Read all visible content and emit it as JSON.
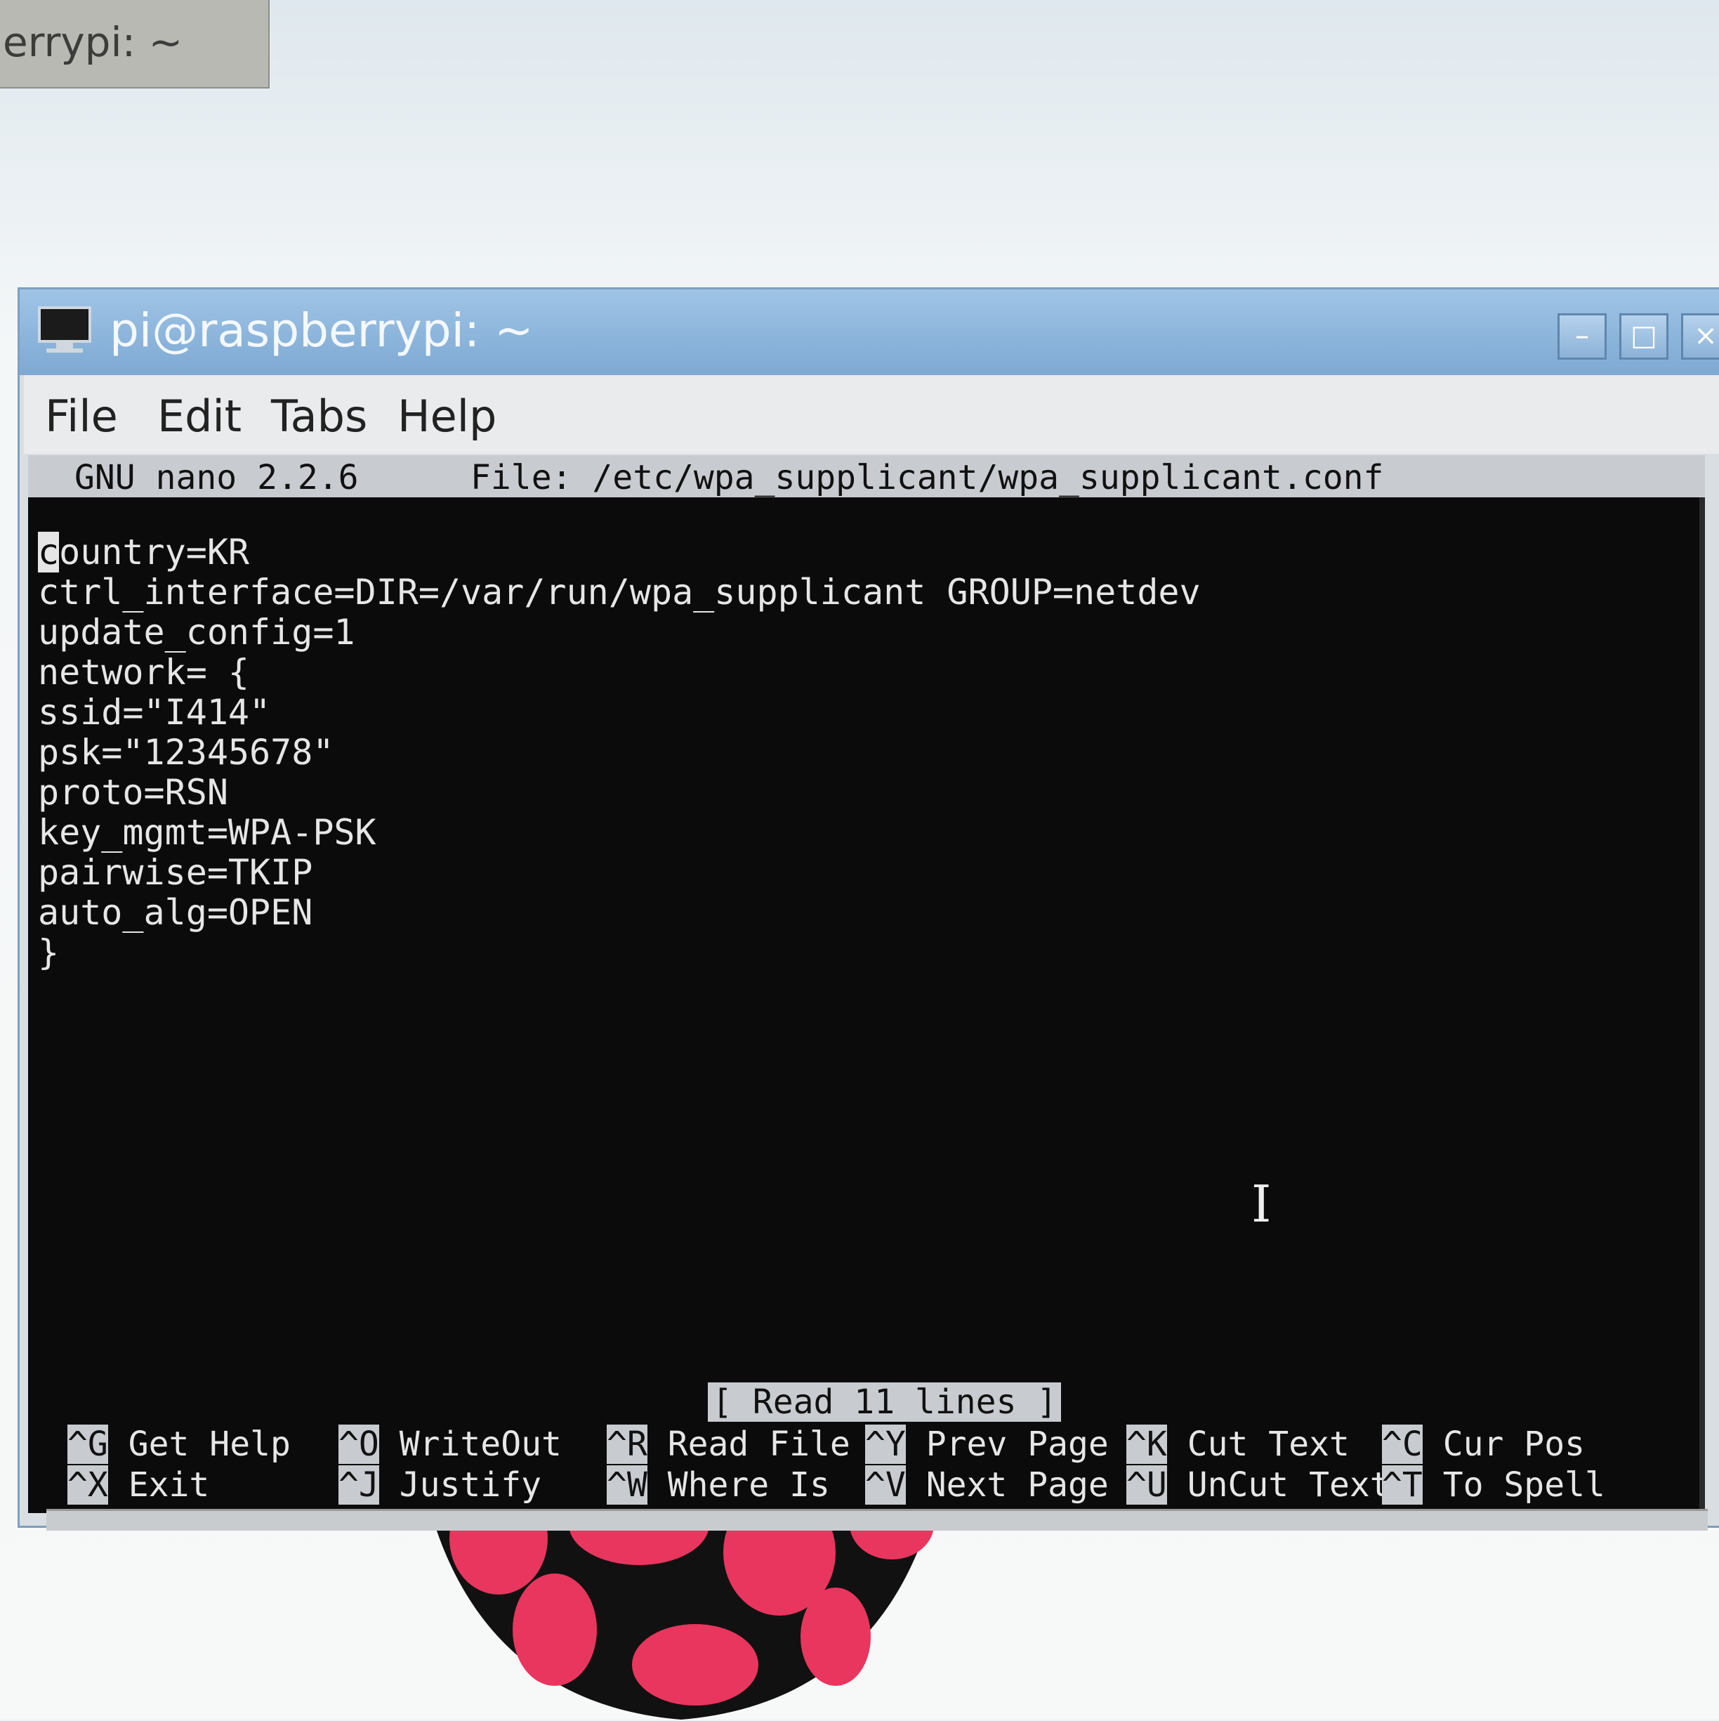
{
  "background_task": {
    "label": "errypi: ~"
  },
  "window": {
    "title": "pi@raspberrypi: ~",
    "controls": {
      "minimize": "–",
      "maximize": "□",
      "close": "×"
    }
  },
  "menubar": {
    "file": "File",
    "edit": "Edit",
    "tabs": "Tabs",
    "help": "Help"
  },
  "nano": {
    "version": "GNU nano 2.2.6",
    "file": "File: /etc/wpa_supplicant/wpa_supplicant.conf",
    "cursor_char": "c",
    "lines": [
      "ountry=KR",
      "ctrl_interface=DIR=/var/run/wpa_supplicant GROUP=netdev",
      "update_config=1",
      "network= {",
      "ssid=\"I414\"",
      "psk=\"12345678\"",
      "proto=RSN",
      "key_mgmt=WPA-PSK",
      "pairwise=TKIP",
      "auto_alg=OPEN",
      "}"
    ],
    "status": "[ Read 11 lines ]",
    "shortcuts": [
      {
        "key": "^G",
        "label": " Get Help"
      },
      {
        "key": "^X",
        "label": " Exit"
      },
      {
        "key": "^O",
        "label": " WriteOut"
      },
      {
        "key": "^J",
        "label": " Justify"
      },
      {
        "key": "^R",
        "label": " Read File"
      },
      {
        "key": "^W",
        "label": " Where Is"
      },
      {
        "key": "^Y",
        "label": " Prev Page"
      },
      {
        "key": "^V",
        "label": " Next Page"
      },
      {
        "key": "^K",
        "label": " Cut Text"
      },
      {
        "key": "^U",
        "label": " UnCut Text"
      },
      {
        "key": "^C",
        "label": " Cur Pos"
      },
      {
        "key": "^T",
        "label": " To Spell"
      }
    ]
  },
  "colors": {
    "titlebar": "#8fb7dd",
    "terminal_bg": "#0b0b0b",
    "terminal_fg": "#e6e6e6",
    "logo_red": "#e8365e"
  }
}
